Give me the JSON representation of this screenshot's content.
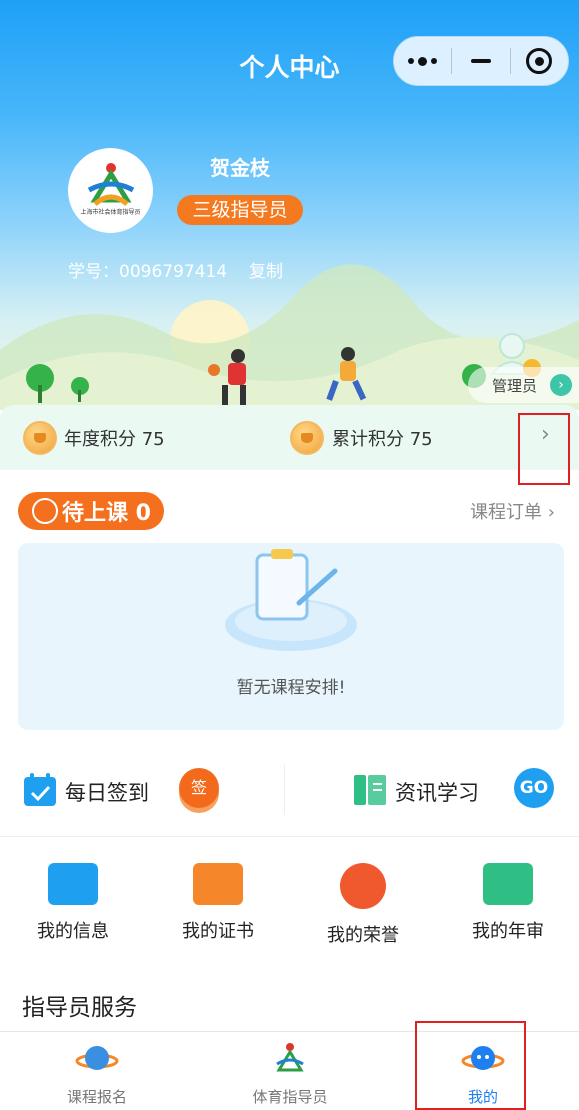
{
  "header": {
    "title": "个人中心",
    "capsule_icons": [
      "more-dots-icon",
      "minimize-icon",
      "close-target-icon"
    ]
  },
  "profile": {
    "name": "贺金枝",
    "level": "三级指导员",
    "student_id": "学号：0096797414",
    "copy_label": "复制",
    "avatar_caption": "上海市社会体育指导员"
  },
  "admin": {
    "label": "管理员",
    "arrow": "›"
  },
  "points": {
    "annual_label": "年度积分 75",
    "total_label": "累计积分 75",
    "chevron": "›"
  },
  "classes": {
    "pending_label": "待上课 0",
    "order_link": "课程订单 ›",
    "empty_text": "暂无课程安排!"
  },
  "quick": {
    "checkin_label": "每日签到",
    "checkin_button": "签",
    "news_label": "资讯学习",
    "news_button": "GO"
  },
  "grid": [
    {
      "label": "我的信息",
      "icon": "id-card-icon",
      "color": "#1e9ff0"
    },
    {
      "label": "我的证书",
      "icon": "certificate-icon",
      "color": "#f5862a"
    },
    {
      "label": "我的荣誉",
      "icon": "medal-icon",
      "color": "#f0582e"
    },
    {
      "label": "我的年审",
      "icon": "annual-review-icon",
      "color": "#2fbf84"
    }
  ],
  "section_title": "指导员服务",
  "tabbar": {
    "items": [
      {
        "label": "课程报名",
        "icon": "basketball-planet-icon"
      },
      {
        "label": "体育指导员",
        "icon": "instructor-logo-icon"
      },
      {
        "label": "我的",
        "icon": "smiley-planet-icon",
        "active": true
      }
    ]
  },
  "colors": {
    "primary": "#1e9ff0",
    "accent_orange": "#f5791f",
    "highlight_box": "#e02020"
  }
}
